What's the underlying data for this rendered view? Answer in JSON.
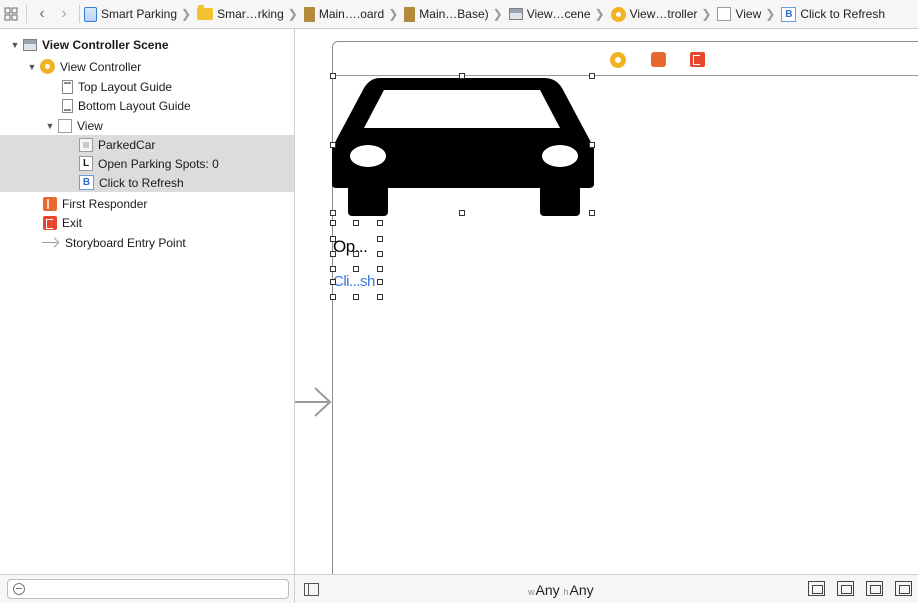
{
  "jumpbar": {
    "crumbs": [
      {
        "label": "Smart Parking",
        "icon": "project-file-icon"
      },
      {
        "label": "Smar…rking",
        "icon": "folder-icon"
      },
      {
        "label": "Main….oard",
        "icon": "storyboard-icon"
      },
      {
        "label": "Main…Base)",
        "icon": "storyboard-icon"
      },
      {
        "label": "View…cene",
        "icon": "scene-icon"
      },
      {
        "label": "View…troller",
        "icon": "view-controller-icon"
      },
      {
        "label": "View",
        "icon": "view-icon"
      },
      {
        "label": "Click to Refresh",
        "icon": "button-icon"
      }
    ],
    "button_glyph": "B"
  },
  "outline": {
    "scene": "View Controller Scene",
    "view_controller": "View Controller",
    "top_layout_guide": "Top Layout Guide",
    "bottom_layout_guide": "Bottom Layout Guide",
    "view": "View",
    "parked_car": "ParkedCar",
    "label_glyph": "L",
    "open_spots_label": "Open Parking Spots: 0",
    "button_glyph": "B",
    "click_refresh": "Click to Refresh",
    "first_responder": "First Responder",
    "exit": "Exit",
    "entry_point": "Storyboard Entry Point"
  },
  "canvas": {
    "label_text_truncated": "Op...",
    "button_text_truncated": "Cli...sh",
    "button_color": "#3a78d6"
  },
  "bottom_bar": {
    "w_prefix": "w",
    "w_value": "Any",
    "h_prefix": "h",
    "h_value": "Any"
  },
  "colors": {
    "selection": "#dcdcdc",
    "view_controller_icon": "#f2b322",
    "first_responder_icon": "#e8692e",
    "exit_icon": "#e8492e"
  }
}
